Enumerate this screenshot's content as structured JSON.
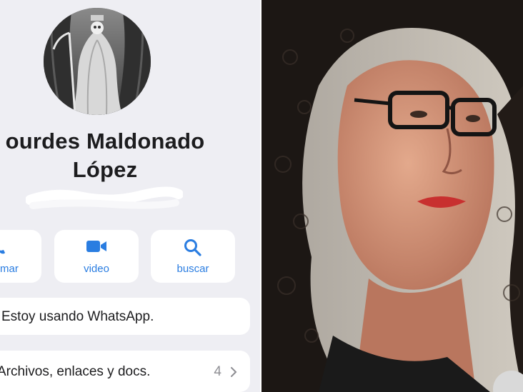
{
  "contact": {
    "name_line1": "ourdes Maldonado",
    "name_line2": "López"
  },
  "actions": [
    {
      "label": "mar",
      "icon": "phone-icon"
    },
    {
      "label": "video",
      "icon": "video-icon"
    },
    {
      "label": "buscar",
      "icon": "search-icon"
    }
  ],
  "status": {
    "text": "Estoy usando WhatsApp."
  },
  "media": {
    "label": "Archivos, enlaces y docs.",
    "count": "4",
    "icon": "chevron-right-icon"
  },
  "colors": {
    "accent": "#2a7de1",
    "background": "#eeeef3"
  }
}
